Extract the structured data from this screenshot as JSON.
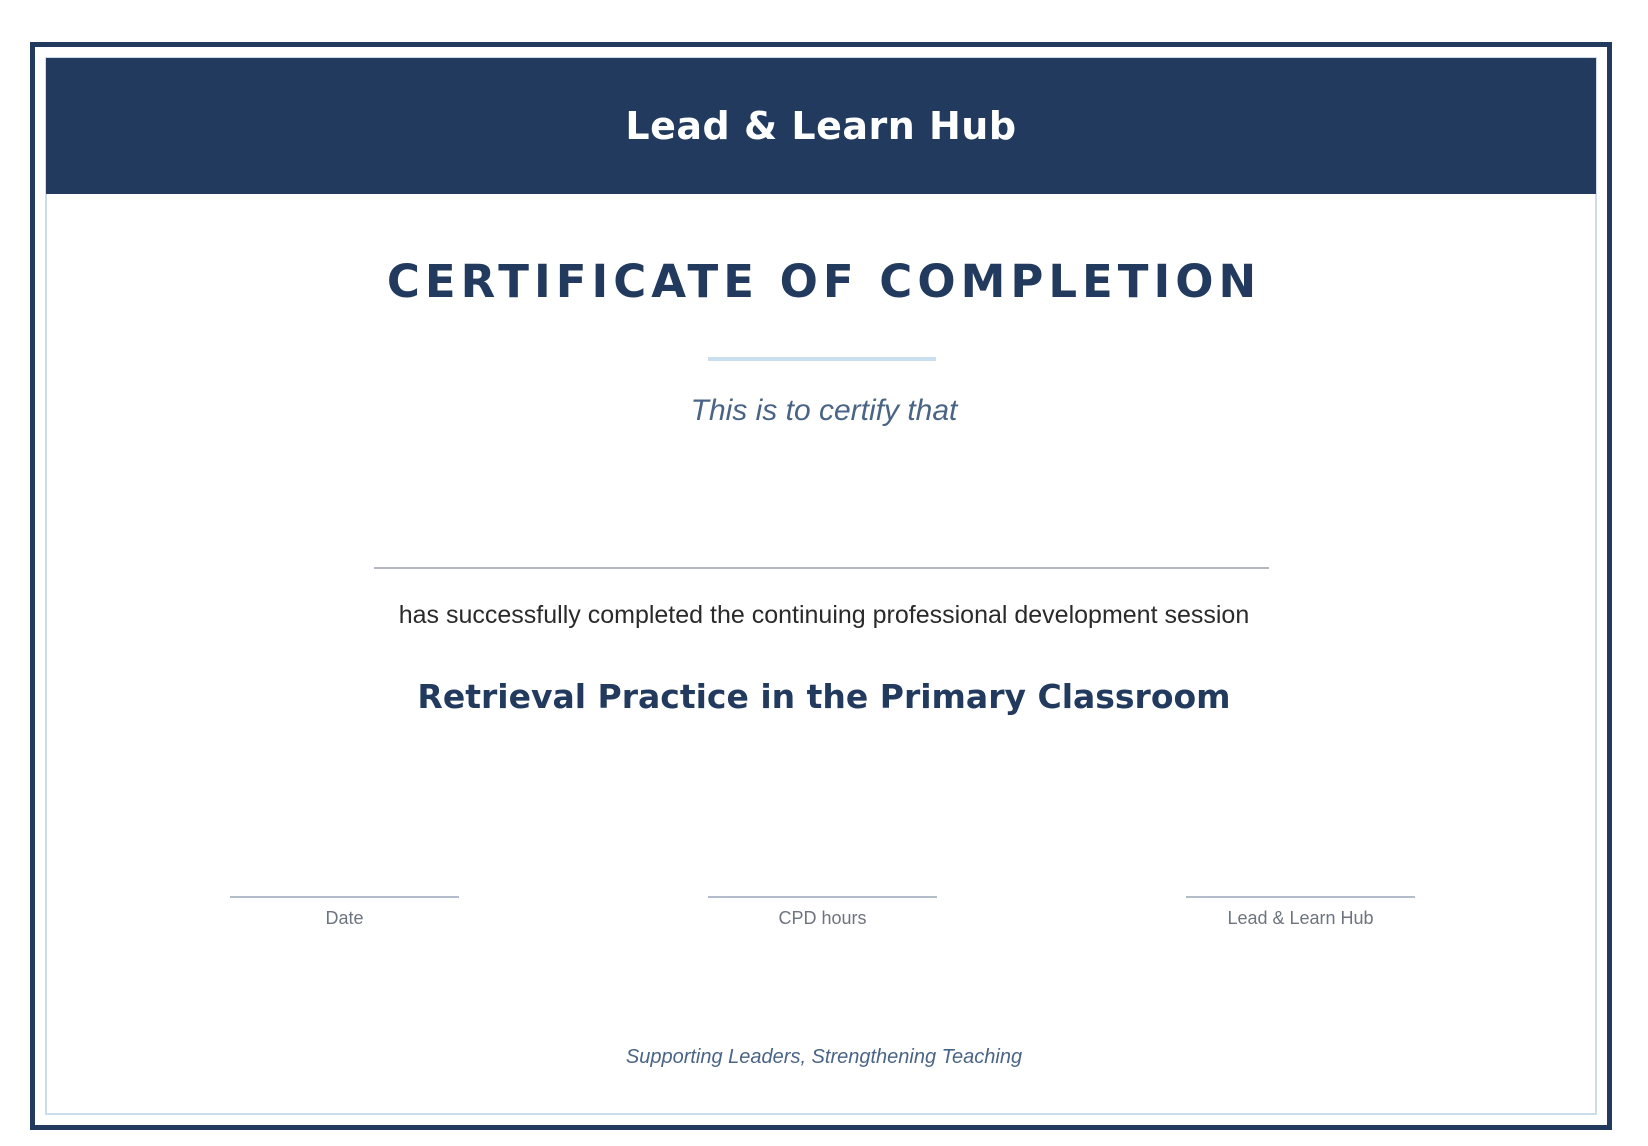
{
  "header": {
    "org_name": "Lead & Learn Hub"
  },
  "certificate": {
    "title": "CERTIFICATE OF COMPLETION",
    "certify_text": "This is to certify that",
    "recipient_name": "",
    "completion_text": "has successfully completed the continuing professional development session",
    "session_title": "Retrieval Practice in the Primary Classroom"
  },
  "signatures": [
    {
      "label": "Date"
    },
    {
      "label": "CPD hours"
    },
    {
      "label": "Lead & Learn Hub"
    }
  ],
  "footer": {
    "tagline": "Supporting Leaders, Strengthening Teaching"
  },
  "colors": {
    "primary_navy": "#213a5e",
    "accent_light_blue": "#c9dff0",
    "muted_text": "#4a6485"
  }
}
